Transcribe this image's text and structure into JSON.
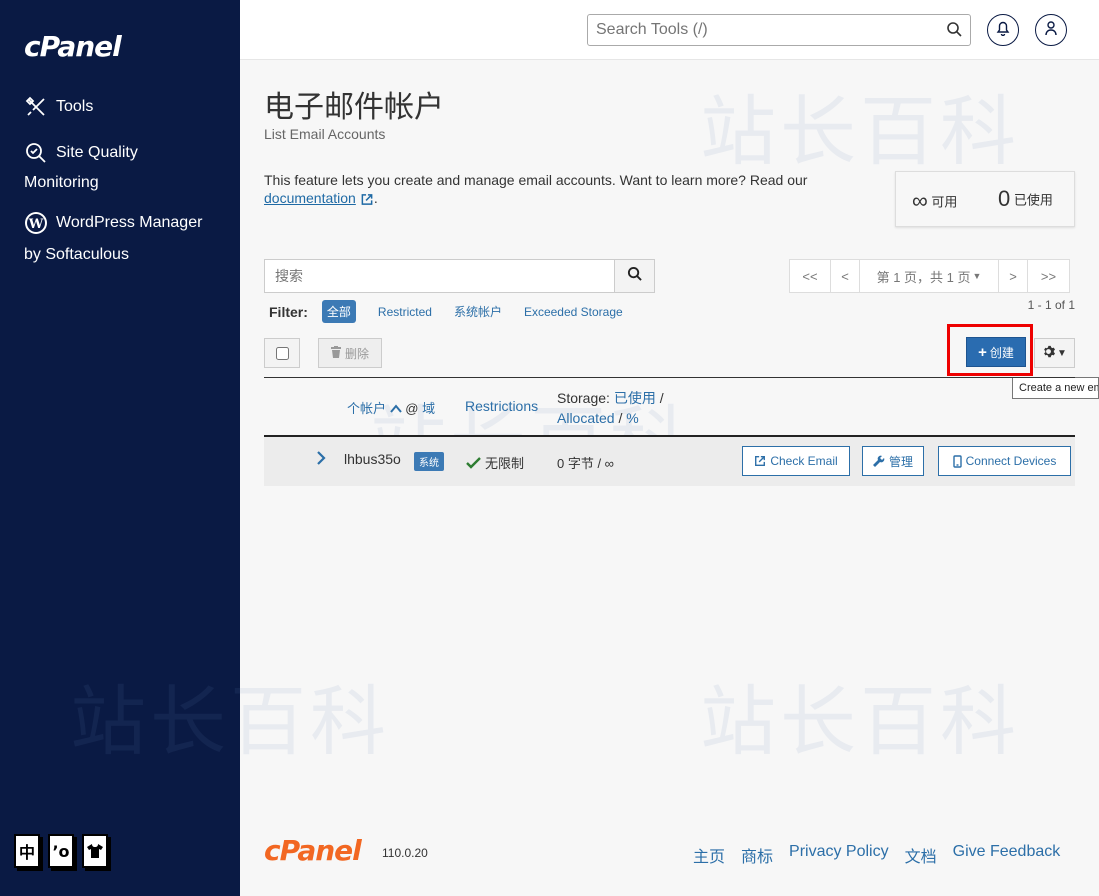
{
  "sidebar": {
    "logo": "cPanel",
    "items": [
      {
        "label": "Tools",
        "icon": "tools-icon"
      },
      {
        "label": "Site Quality",
        "label2": "Monitoring",
        "icon": "site-quality-icon"
      },
      {
        "label": "WordPress Manager",
        "label2": "by Softaculous",
        "icon": "wordpress-icon"
      }
    ],
    "lang_icons": [
      "中",
      "’o",
      "👕"
    ]
  },
  "topbar": {
    "search_placeholder": "Search Tools (/)",
    "notifications_icon": "bell-icon",
    "user_icon": "user-icon"
  },
  "watermark": "站长百科",
  "page": {
    "title": "电子邮件帐户",
    "subtitle": "List Email Accounts",
    "description": "This feature lets you create and manage email accounts. Want to learn more? Read our",
    "doc_link": "documentation",
    "desc_end": "."
  },
  "stats": {
    "available_value": "∞",
    "available_label": "可用",
    "used_value": "0",
    "used_label": "已使用"
  },
  "list": {
    "search_placeholder": "搜索",
    "pager": {
      "first": "<<",
      "prev": "<",
      "page_label": "第 1 页，共 1 页",
      "next": ">",
      "last": ">>",
      "info": "1 - 1 of 1"
    },
    "filter": {
      "label": "Filter:",
      "items": [
        "全部",
        "Restricted",
        "系统帐户",
        "Exceeded Storage"
      ]
    },
    "delete_label": "删除",
    "create_label": "创建",
    "tooltip": "Create a new email account",
    "headers": {
      "account": "个帐户",
      "at": "@",
      "domain": "域",
      "restrictions": "Restrictions",
      "storage": "Storage:",
      "used": "已使用",
      "slash1": "/",
      "allocated": "Allocated",
      "slash2": "/",
      "percent": "%"
    },
    "rows": [
      {
        "user": "lhbus35o",
        "badge": "系统",
        "restriction": "无限制",
        "storage": "0 字节 / ∞",
        "check_email": "Check Email",
        "manage": "管理",
        "connect": "Connect Devices"
      }
    ]
  },
  "footer": {
    "logo": "cPanel",
    "version": "110.0.20",
    "links": [
      "主页",
      "商标",
      "Privacy Policy",
      "文档",
      "Give Feedback"
    ]
  },
  "colors": {
    "sidebar": "#0a1a44",
    "accent": "#2c6fa8",
    "create": "#2a6cb0",
    "highlight": "#e00000",
    "footer_logo": "#f26722"
  }
}
